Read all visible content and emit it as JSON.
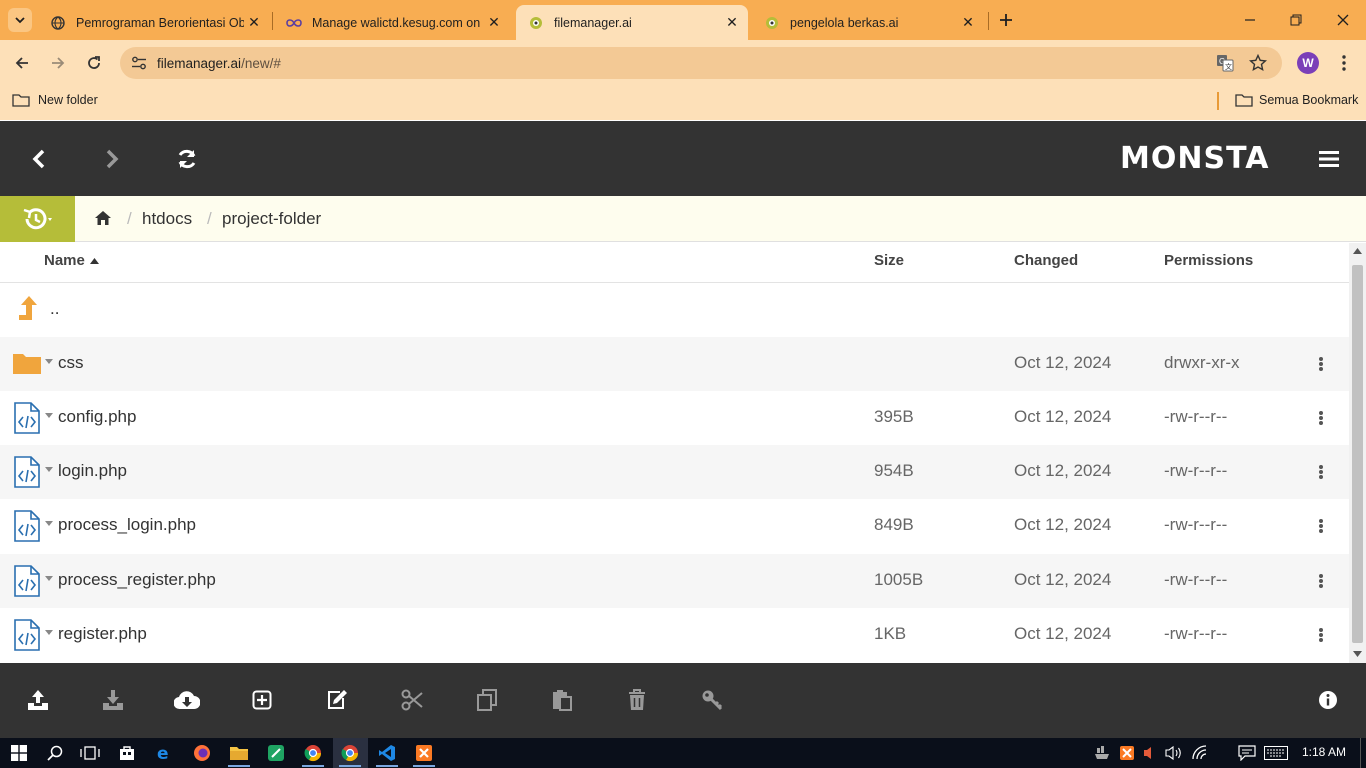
{
  "browser": {
    "tabs": [
      {
        "title": "Pemrograman Berorientasi Obje",
        "favicon": "globe-icon"
      },
      {
        "title": "Manage walictd.kesug.com on I",
        "favicon": "infinity-icon"
      },
      {
        "title": "filemanager.ai",
        "favicon": "monsta-icon",
        "active": true
      },
      {
        "title": "pengelola berkas.ai",
        "favicon": "monsta-icon"
      }
    ],
    "address": {
      "host": "filemanager.ai",
      "path": "/new/#"
    },
    "profile_initial": "W",
    "bookmarks": {
      "left": "New folder",
      "right": "Semua Bookmark"
    }
  },
  "app": {
    "logo": "MONSTA",
    "breadcrumb": [
      "htdocs",
      "project-folder"
    ],
    "columns": {
      "name": "Name",
      "size": "Size",
      "changed": "Changed",
      "permissions": "Permissions"
    },
    "parent_label": "..",
    "rows": [
      {
        "name": "css",
        "size": "",
        "changed": "Oct 12, 2024",
        "permissions": "drwxr-xr-x",
        "type": "folder"
      },
      {
        "name": "config.php",
        "size": "395B",
        "changed": "Oct 12, 2024",
        "permissions": "-rw-r--r--",
        "type": "code"
      },
      {
        "name": "login.php",
        "size": "954B",
        "changed": "Oct 12, 2024",
        "permissions": "-rw-r--r--",
        "type": "code"
      },
      {
        "name": "process_login.php",
        "size": "849B",
        "changed": "Oct 12, 2024",
        "permissions": "-rw-r--r--",
        "type": "code"
      },
      {
        "name": "process_register.php",
        "size": "1005B",
        "changed": "Oct 12, 2024",
        "permissions": "-rw-r--r--",
        "type": "code"
      },
      {
        "name": "register.php",
        "size": "1KB",
        "changed": "Oct 12, 2024",
        "permissions": "-rw-r--r--",
        "type": "code"
      }
    ]
  },
  "taskbar": {
    "time": "1:18 AM"
  },
  "colors": {
    "tabstrip": "#f8ad52",
    "toolbar": "#fde0b8",
    "header": "#333333",
    "accent": "#b5bd39",
    "folder": "#f0a53d",
    "code": "#2a6fb0"
  }
}
